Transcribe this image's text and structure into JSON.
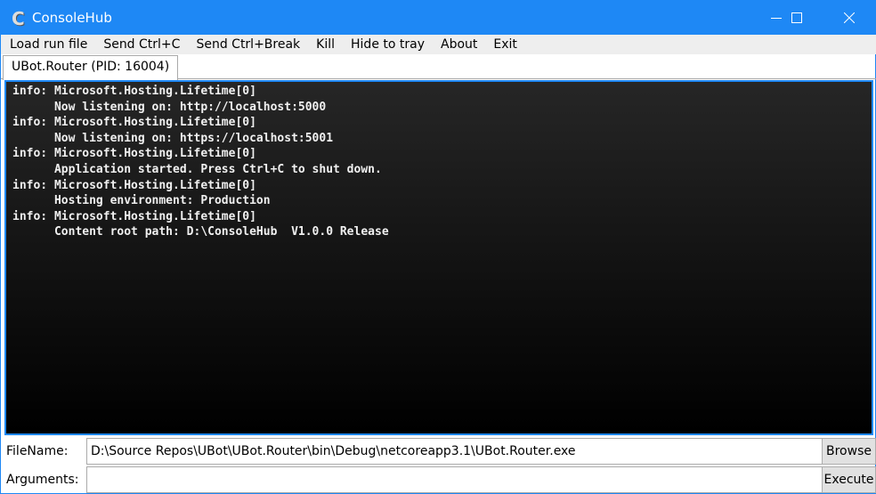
{
  "window": {
    "title": "ConsoleHub",
    "logo": "C"
  },
  "menu": [
    "Load run file",
    "Send Ctrl+C",
    "Send Ctrl+Break",
    "Kill",
    "Hide to tray",
    "About",
    "Exit"
  ],
  "tab": {
    "label": "UBot.Router (PID: 16004)"
  },
  "console": {
    "lines": [
      "info: Microsoft.Hosting.Lifetime[0]",
      "      Now listening on: http://localhost:5000",
      "info: Microsoft.Hosting.Lifetime[0]",
      "      Now listening on: https://localhost:5001",
      "info: Microsoft.Hosting.Lifetime[0]",
      "      Application started. Press Ctrl+C to shut down.",
      "info: Microsoft.Hosting.Lifetime[0]",
      "      Hosting environment: Production",
      "info: Microsoft.Hosting.Lifetime[0]",
      "      Content root path: D:\\ConsoleHub  V1.0.0 Release"
    ]
  },
  "filename": {
    "label": "FileName:",
    "value": "D:\\Source Repos\\UBot\\UBot.Router\\bin\\Debug\\netcoreapp3.1\\UBot.Router.exe",
    "button": "Browse"
  },
  "arguments": {
    "label": "Arguments:",
    "value": "",
    "button": "Execute"
  }
}
